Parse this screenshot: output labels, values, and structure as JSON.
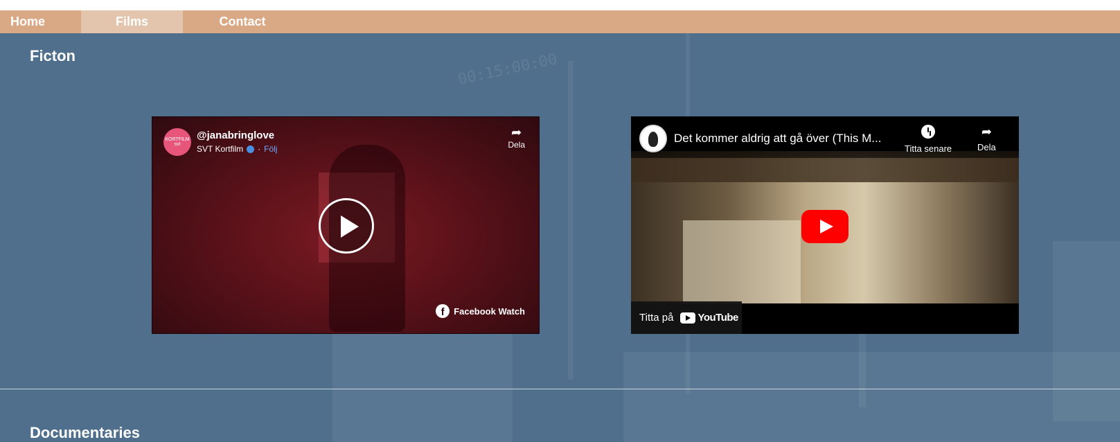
{
  "nav": {
    "items": [
      {
        "label": "Home"
      },
      {
        "label": "Films"
      },
      {
        "label": "Contact"
      }
    ],
    "active": "Films"
  },
  "background": {
    "timecode": "00:15:00:00"
  },
  "sections": {
    "fiction": {
      "title": "Ficton"
    },
    "documentaries": {
      "title": "Documentaries"
    }
  },
  "facebook_video": {
    "avatar_text_top": "KORTFILM",
    "avatar_text_bottom": "svt",
    "handle": "@janabringlove",
    "channel": "SVT Kortfilm",
    "follow": "Följ",
    "share_label": "Dela",
    "watch_label": "Facebook Watch"
  },
  "youtube_video": {
    "title": "Det kommer aldrig att gå över (This M...",
    "watch_later_label": "Titta senare",
    "share_label": "Dela",
    "watch_on_label": "Titta på",
    "logo_text": "YouTube"
  },
  "colors": {
    "nav_bg": "#d9a885",
    "nav_active": "#e3c4ac",
    "page_bg": "#4f6f8c",
    "youtube_red": "#ff0000"
  }
}
